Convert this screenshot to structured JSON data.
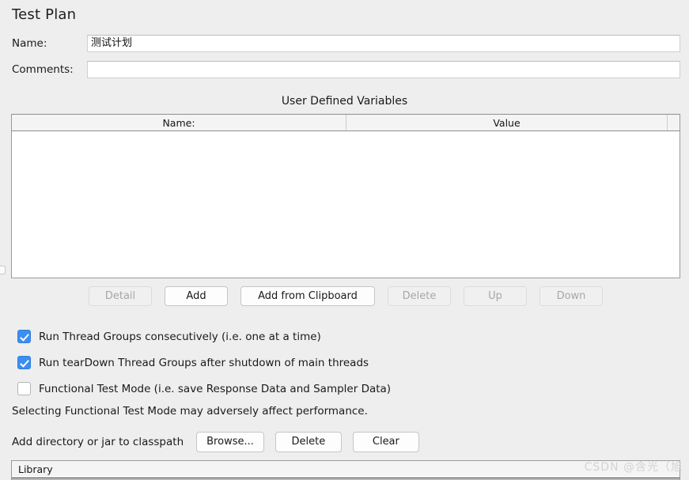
{
  "page": {
    "title": "Test Plan",
    "background_color": "#eeeeee"
  },
  "fields": {
    "name": {
      "label": "Name:",
      "value": "测试计划",
      "placeholder": ""
    },
    "comments": {
      "label": "Comments:",
      "value": "",
      "placeholder": ""
    }
  },
  "user_defined_variables": {
    "title": "User Defined Variables",
    "columns": [
      "Name:",
      "Value"
    ],
    "rows": [],
    "buttons": [
      {
        "label": "Detail",
        "enabled": false
      },
      {
        "label": "Add",
        "enabled": true
      },
      {
        "label": "Add from Clipboard",
        "enabled": true
      },
      {
        "label": "Delete",
        "enabled": false
      },
      {
        "label": "Up",
        "enabled": false
      },
      {
        "label": "Down",
        "enabled": false
      }
    ]
  },
  "options": {
    "checkboxes": [
      {
        "label": "Run Thread Groups consecutively (i.e. one at a time)",
        "checked": true
      },
      {
        "label": "Run tearDown Thread Groups after shutdown of main threads",
        "checked": true
      },
      {
        "label": "Functional Test Mode (i.e. save Response Data and Sampler Data)",
        "checked": false
      }
    ],
    "warning": "Selecting Functional Test Mode may adversely affect performance."
  },
  "classpath": {
    "label": "Add directory or jar to classpath",
    "buttons": [
      {
        "label": "Browse...",
        "enabled": true
      },
      {
        "label": "Delete",
        "enabled": true
      },
      {
        "label": "Clear",
        "enabled": true
      }
    ],
    "table": {
      "columns": [
        "Library"
      ],
      "rows": []
    }
  },
  "watermark": {
    "text": "CSDN @含光（旭",
    "color": "#d3d3d3"
  },
  "colors": {
    "checkbox_accent": "#3c8ef1",
    "panel_background": "#eeeeee",
    "table_header": "#f4f4f4",
    "border": "#9a9a9a",
    "disabled_text": "#a7a7a7"
  }
}
